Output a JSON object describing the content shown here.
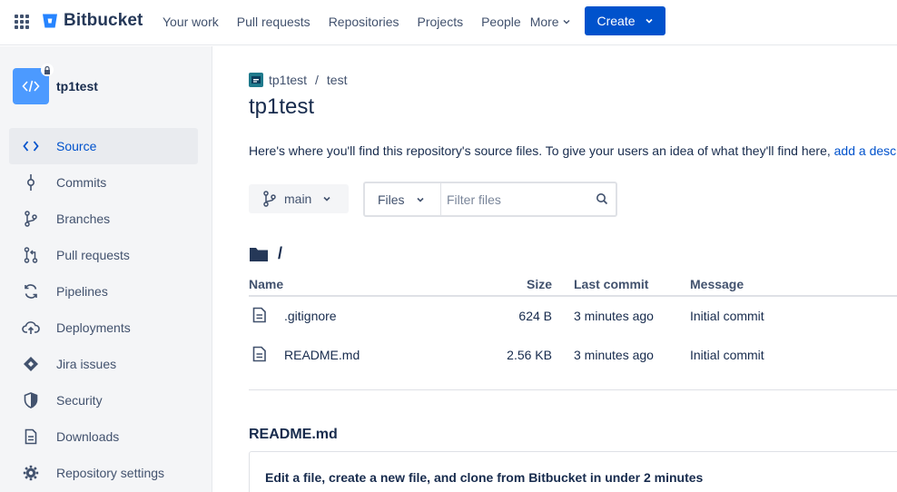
{
  "topnav": {
    "product": "Bitbucket",
    "links": [
      "Your work",
      "Pull requests",
      "Repositories",
      "Projects",
      "People"
    ],
    "more_label": "More",
    "create_label": "Create"
  },
  "sidebar": {
    "repo_name": "tp1test",
    "items": [
      {
        "label": "Source",
        "icon": "source-icon",
        "active": true
      },
      {
        "label": "Commits",
        "icon": "commit-icon"
      },
      {
        "label": "Branches",
        "icon": "branch-icon"
      },
      {
        "label": "Pull requests",
        "icon": "pull-request-icon"
      },
      {
        "label": "Pipelines",
        "icon": "pipelines-icon"
      },
      {
        "label": "Deployments",
        "icon": "deployments-icon"
      },
      {
        "label": "Jira issues",
        "icon": "jira-icon"
      },
      {
        "label": "Security",
        "icon": "shield-icon"
      },
      {
        "label": "Downloads",
        "icon": "downloads-icon"
      },
      {
        "label": "Repository settings",
        "icon": "gear-icon"
      }
    ]
  },
  "breadcrumb": {
    "project": "tp1test",
    "separator": "/",
    "repo": "test"
  },
  "page_title": "tp1test",
  "description": {
    "text": "Here's where you'll find this repository's source files. To give your users an idea of what they'll find here,",
    "link": "add a description"
  },
  "branch": {
    "label": "main"
  },
  "filter": {
    "select_label": "Files",
    "placeholder": "Filter files"
  },
  "path": "/",
  "table": {
    "headers": {
      "name": "Name",
      "size": "Size",
      "last_commit": "Last commit",
      "message": "Message"
    },
    "rows": [
      {
        "name": ".gitignore",
        "size": "624 B",
        "last_commit": "3 minutes ago",
        "message": "Initial commit"
      },
      {
        "name": "README.md",
        "size": "2.56 KB",
        "last_commit": "3 minutes ago",
        "message": "Initial commit"
      }
    ]
  },
  "readme": {
    "title": "README.md",
    "heading": "Edit a file, create a new file, and clone from Bitbucket in under 2 minutes"
  },
  "colors": {
    "primary": "#0052cc",
    "sidebar_bg": "#f4f5f7",
    "text": "#172b4d",
    "muted": "#42526e"
  }
}
